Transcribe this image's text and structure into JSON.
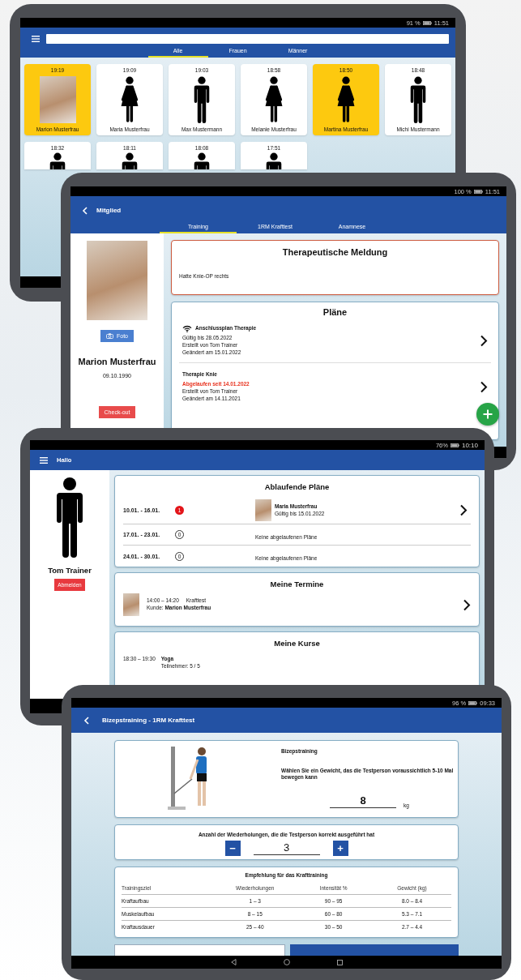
{
  "member_list_screen": {
    "status_bar": {
      "battery": "91 %",
      "time": "11:51"
    },
    "tabs": [
      {
        "label": "Alle",
        "selected": true
      },
      {
        "label": "Frauen",
        "selected": false
      },
      {
        "label": "Männer",
        "selected": false
      }
    ],
    "members": [
      {
        "time": "19:19",
        "name": "Marion Musterfrau",
        "kind": "photo",
        "selected": true
      },
      {
        "time": "19:09",
        "name": "Maria Musterfrau",
        "kind": "female",
        "selected": false
      },
      {
        "time": "19:03",
        "name": "Max Mustermann",
        "kind": "male",
        "selected": false
      },
      {
        "time": "18:58",
        "name": "Melanie Musterfrau",
        "kind": "female",
        "selected": false
      },
      {
        "time": "18:50",
        "name": "Martina Musterfrau",
        "kind": "female",
        "selected": true
      },
      {
        "time": "18:48",
        "name": "Michi Mustermann",
        "kind": "male",
        "selected": false
      },
      {
        "time": "18:32",
        "kind": "male",
        "selected": false
      },
      {
        "time": "18:11",
        "kind": "male",
        "selected": false
      },
      {
        "time": "18:08",
        "kind": "male",
        "selected": false
      },
      {
        "time": "17:51",
        "kind": "male",
        "selected": false
      }
    ]
  },
  "member_screen": {
    "status_bar": {
      "battery": "100 %",
      "time": "11:51"
    },
    "title": "Mitglied",
    "tabs": [
      {
        "label": "Training",
        "selected": true
      },
      {
        "label": "1RM Krafttest",
        "selected": false
      },
      {
        "label": "Anamnese",
        "selected": false
      }
    ],
    "profile": {
      "photo_button": "Foto",
      "name": "Marion Musterfrau",
      "birth_date": "09.10.1990",
      "checkout_button": "Check-out"
    },
    "therapy_note": {
      "title": "Therapeutische Meldung",
      "text": "Hatte Knie-OP rechts"
    },
    "plans": {
      "title": "Pläne",
      "items": [
        {
          "name": "Anschlussplan Therapie",
          "wireless": true,
          "status": "Gültig bis 28.05.2022",
          "expired": false,
          "created": "Erstellt von Tom Trainer",
          "changed": "Geändert am 15.01.2022"
        },
        {
          "name": "Therapie Knie",
          "wireless": false,
          "status": "Abgelaufen seit 14.01.2022",
          "expired": true,
          "created": "Erstellt von Tom Trainer",
          "changed": "Geändert am 14.11.2021"
        }
      ]
    }
  },
  "dashboard_screen": {
    "status_bar": {
      "battery": "76%",
      "time": "10:10"
    },
    "title": "Hallo",
    "user": {
      "name": "Tom Trainer",
      "logout_button": "Abmelden"
    },
    "expiring_plans": {
      "title": "Ablaufende Pläne",
      "weeks": [
        {
          "range": "10.01. - 16.01.",
          "count": "1",
          "kind": "alert",
          "client": {
            "name": "Maria Musterfrau",
            "valid": "Gültig bis 15.01.2022"
          }
        },
        {
          "range": "17.01. - 23.01.",
          "count": "0",
          "kind": "none",
          "message": "Keine abgelaufenen Pläne"
        },
        {
          "range": "24.01. - 30.01.",
          "count": "0",
          "kind": "none",
          "message": "Keine abgelaufenen Pläne"
        }
      ]
    },
    "appointments": {
      "title": "Meine Termine",
      "items": [
        {
          "time": "14:00 – 14:20",
          "type": "Krafttest",
          "client": "Kunde: **Marion Musterfrau**"
        }
      ]
    },
    "courses": {
      "title": "Meine Kurse",
      "items": [
        {
          "time": "18:30 – 19:30",
          "name": "Yoga",
          "participants": "Teilnehmer: 5 / 5"
        }
      ]
    }
  },
  "strength_test_screen": {
    "status_bar": {
      "battery": "96 %",
      "time": "09:33"
    },
    "title": "Bizepstraining - 1RM Krafttest",
    "exercise": {
      "name": "Bizepstraining",
      "instruction": "Wählen Sie ein Gewicht, das die Testperson voraussichtlich 5-10 Mal bewegen kann",
      "weight": "8",
      "unit": "kg"
    },
    "repetitions": {
      "label": "Anzahl der Wiederholungen, die die Testperson korrekt ausgeführt hat",
      "minus": "−",
      "value": "3",
      "plus": "+"
    },
    "recommendation": {
      "title": "Empfehlung für das Krafttraining",
      "columns": [
        "Trainingsziel",
        "Wiederholungen",
        "Intensität %",
        "Gewicht (kg)"
      ],
      "rows": [
        [
          "Kraftaufbau",
          "1 – 3",
          "90 – 95",
          "8.0 – 8.4"
        ],
        [
          "Muskelaufbau",
          "8 – 15",
          "60 – 80",
          "5.3 – 7.1"
        ],
        [
          "Kraftausdauer",
          "25 – 40",
          "30 – 50",
          "2.7 – 4.4"
        ]
      ]
    }
  }
}
